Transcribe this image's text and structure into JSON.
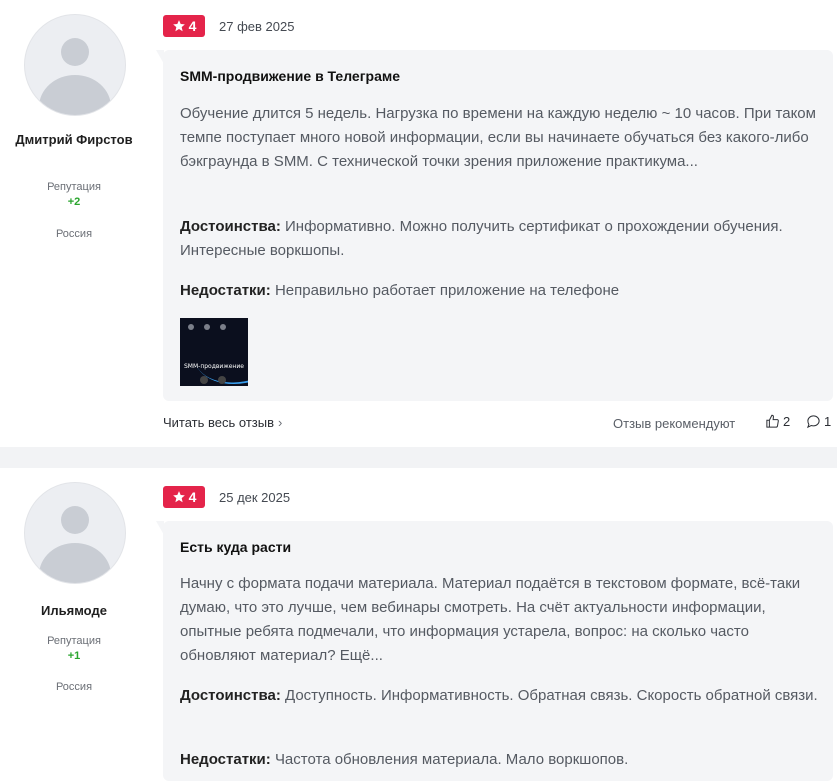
{
  "reviews": [
    {
      "author": "Дмитрий Фирстов",
      "reputation_label": "Репутация",
      "reputation_value": "+2",
      "country": "Россия",
      "rating": "4",
      "date": "27 фев 2025",
      "title": "SMM-продвижение в Телеграме",
      "text": "Обучение длится 5 недель. Нагрузка по времени на каждую неделю ~ 10 часов. При таком темпе поступает много новой информации, если вы начинаете обучаться без какого-либо бэкграунда в SMM. С технической точки зрения приложение практикума...",
      "pros_label": "Достоинства:",
      "pros": "Информативно. Можно получить сертификат о прохождении обучения. Интересные воркшопы.",
      "cons_label": "Недостатки:",
      "cons": "Неправильно работает приложение на телефоне",
      "thumb_caption": "SMM-продвижение",
      "read_more": "Читать весь отзыв",
      "recommend_label": "Отзыв рекомендуют",
      "likes": "2",
      "comments": "1"
    },
    {
      "author": "Ильямоде",
      "reputation_label": "Репутация",
      "reputation_value": "+1",
      "country": "Россия",
      "rating": "4",
      "date": "25 дек 2025",
      "title": "Есть куда расти",
      "text": "Начну с формата подачи материала. Материал подаётся в текстовом формате, всё-таки думаю, что это лучше, чем вебинары смотреть. На счёт актуальности информации, опытные ребята подмечали, что информация устарела, вопрос: на сколько часто обновляют материал? Ещё...",
      "pros_label": "Достоинства:",
      "pros": "Доступность. Информативность. Обратная связь. Скорость обратной связи.",
      "cons_label": "Недостатки:",
      "cons": "Частота обновления материала. Мало воркшопов."
    }
  ],
  "colors": {
    "badge": "#e4244a",
    "reputation": "#2aa52e",
    "card_bg": "#f4f5f7"
  },
  "icons": {
    "rating": "star-icon",
    "avatar": "user-placeholder-icon",
    "like": "thumbs-up-icon",
    "comment": "comment-icon",
    "more": "chevron-right-icon"
  }
}
